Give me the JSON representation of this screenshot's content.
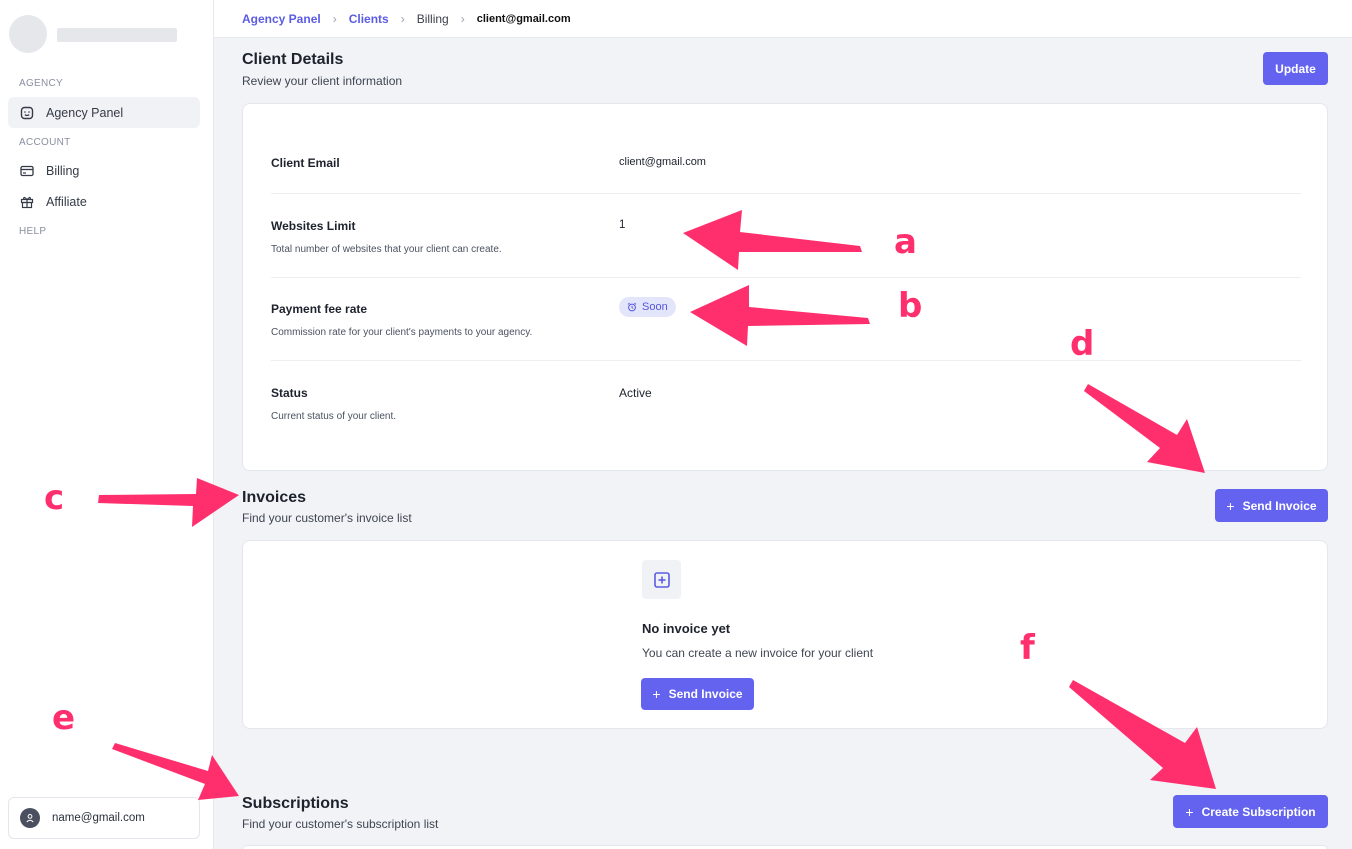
{
  "sidebar": {
    "sections": {
      "agency": "AGENCY",
      "account": "ACCOUNT",
      "help": "HELP"
    },
    "items": [
      {
        "label": "Agency Panel",
        "icon": "smile-square-icon",
        "active": true
      },
      {
        "label": "Billing",
        "icon": "credit-card-icon"
      },
      {
        "label": "Affiliate",
        "icon": "gift-icon"
      }
    ],
    "user_email": "name@gmail.com"
  },
  "breadcrumb": [
    "Agency Panel",
    "Clients",
    "Billing",
    "client@gmail.com"
  ],
  "client_details": {
    "title": "Client Details",
    "subtitle": "Review your client information",
    "update_label": "Update",
    "rows": [
      {
        "label": "Client Email",
        "value": "client@gmail.com"
      },
      {
        "label": "Websites Limit",
        "desc": "Total number of websites that your client can create.",
        "value": "1"
      },
      {
        "label": "Payment fee rate",
        "desc": "Commission rate for your client's payments to your agency.",
        "badge": "Soon"
      },
      {
        "label": "Status",
        "desc": "Current status of your client.",
        "value": "Active"
      }
    ]
  },
  "invoices": {
    "title": "Invoices",
    "subtitle": "Find your customer's invoice list",
    "send_label": "Send Invoice",
    "empty_title": "No invoice yet",
    "empty_desc": "You can create a new invoice for your client",
    "empty_button": "Send Invoice"
  },
  "subscriptions": {
    "title": "Subscriptions",
    "subtitle": "Find your customer's subscription list",
    "create_label": "Create Subscription"
  },
  "annotations": [
    "a",
    "b",
    "c",
    "d",
    "e",
    "f"
  ],
  "colors": {
    "accent": "#6463f0",
    "annotation": "#ff2f6e",
    "badge_bg": "#e3e5fb"
  }
}
